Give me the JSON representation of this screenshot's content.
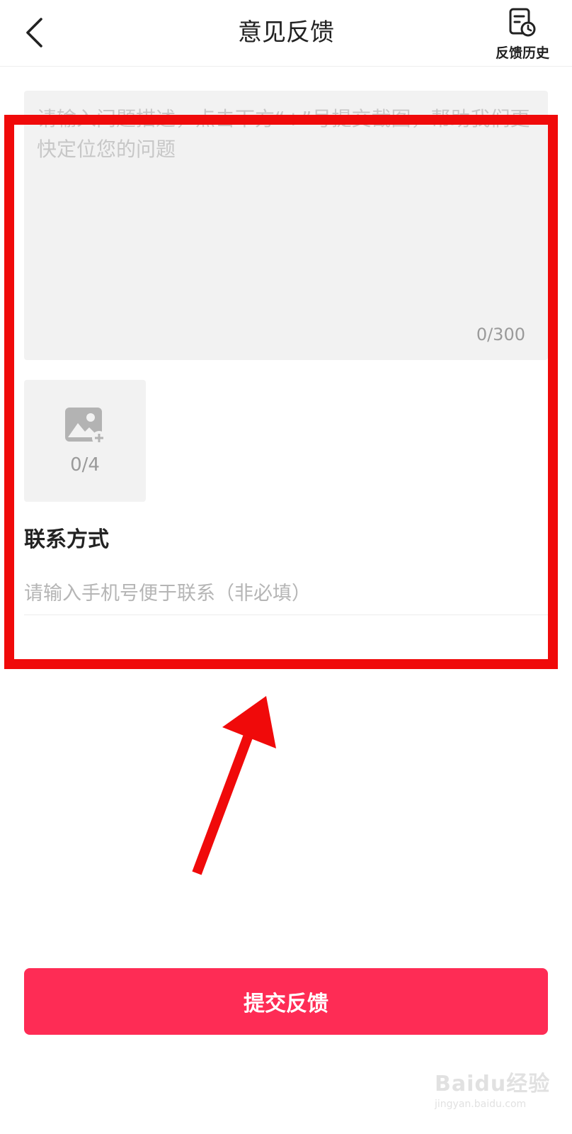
{
  "header": {
    "title": "意见反馈",
    "history_label": "反馈历史"
  },
  "feedback": {
    "placeholder": "请输入问题描述，点击下方“+”号提交截图，帮助我们更快定位您的问题",
    "char_count": "0/300"
  },
  "upload": {
    "count": "0/4"
  },
  "contact": {
    "title": "联系方式",
    "placeholder": "请输入手机号便于联系（非必填）"
  },
  "submit": {
    "label": "提交反馈"
  },
  "watermark": {
    "brand": "Baidu经验",
    "url": "jingyan.baidu.com"
  },
  "colors": {
    "accent": "#fe2c55",
    "annotation": "#f00a0a",
    "field_bg": "#f2f2f2"
  },
  "icons": {
    "back": "chevron-left-icon",
    "history": "document-clock-icon",
    "upload": "image-add-icon"
  }
}
